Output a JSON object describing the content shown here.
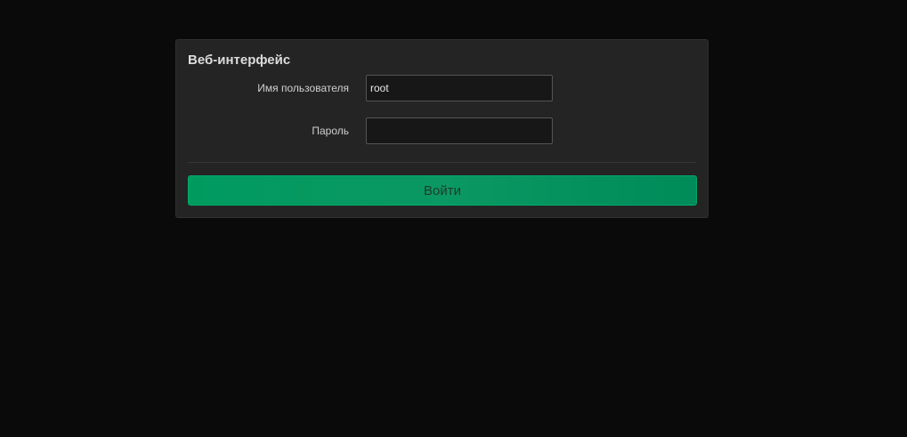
{
  "panel": {
    "title": "Веб-интерфейс"
  },
  "form": {
    "username": {
      "label": "Имя пользователя",
      "value": "root",
      "placeholder": ""
    },
    "password": {
      "label": "Пароль",
      "value": "",
      "placeholder": ""
    },
    "submit_label": "Войти"
  },
  "colors": {
    "background": "#0a0a0a",
    "panel": "#242424",
    "accent": "#009a5f"
  }
}
